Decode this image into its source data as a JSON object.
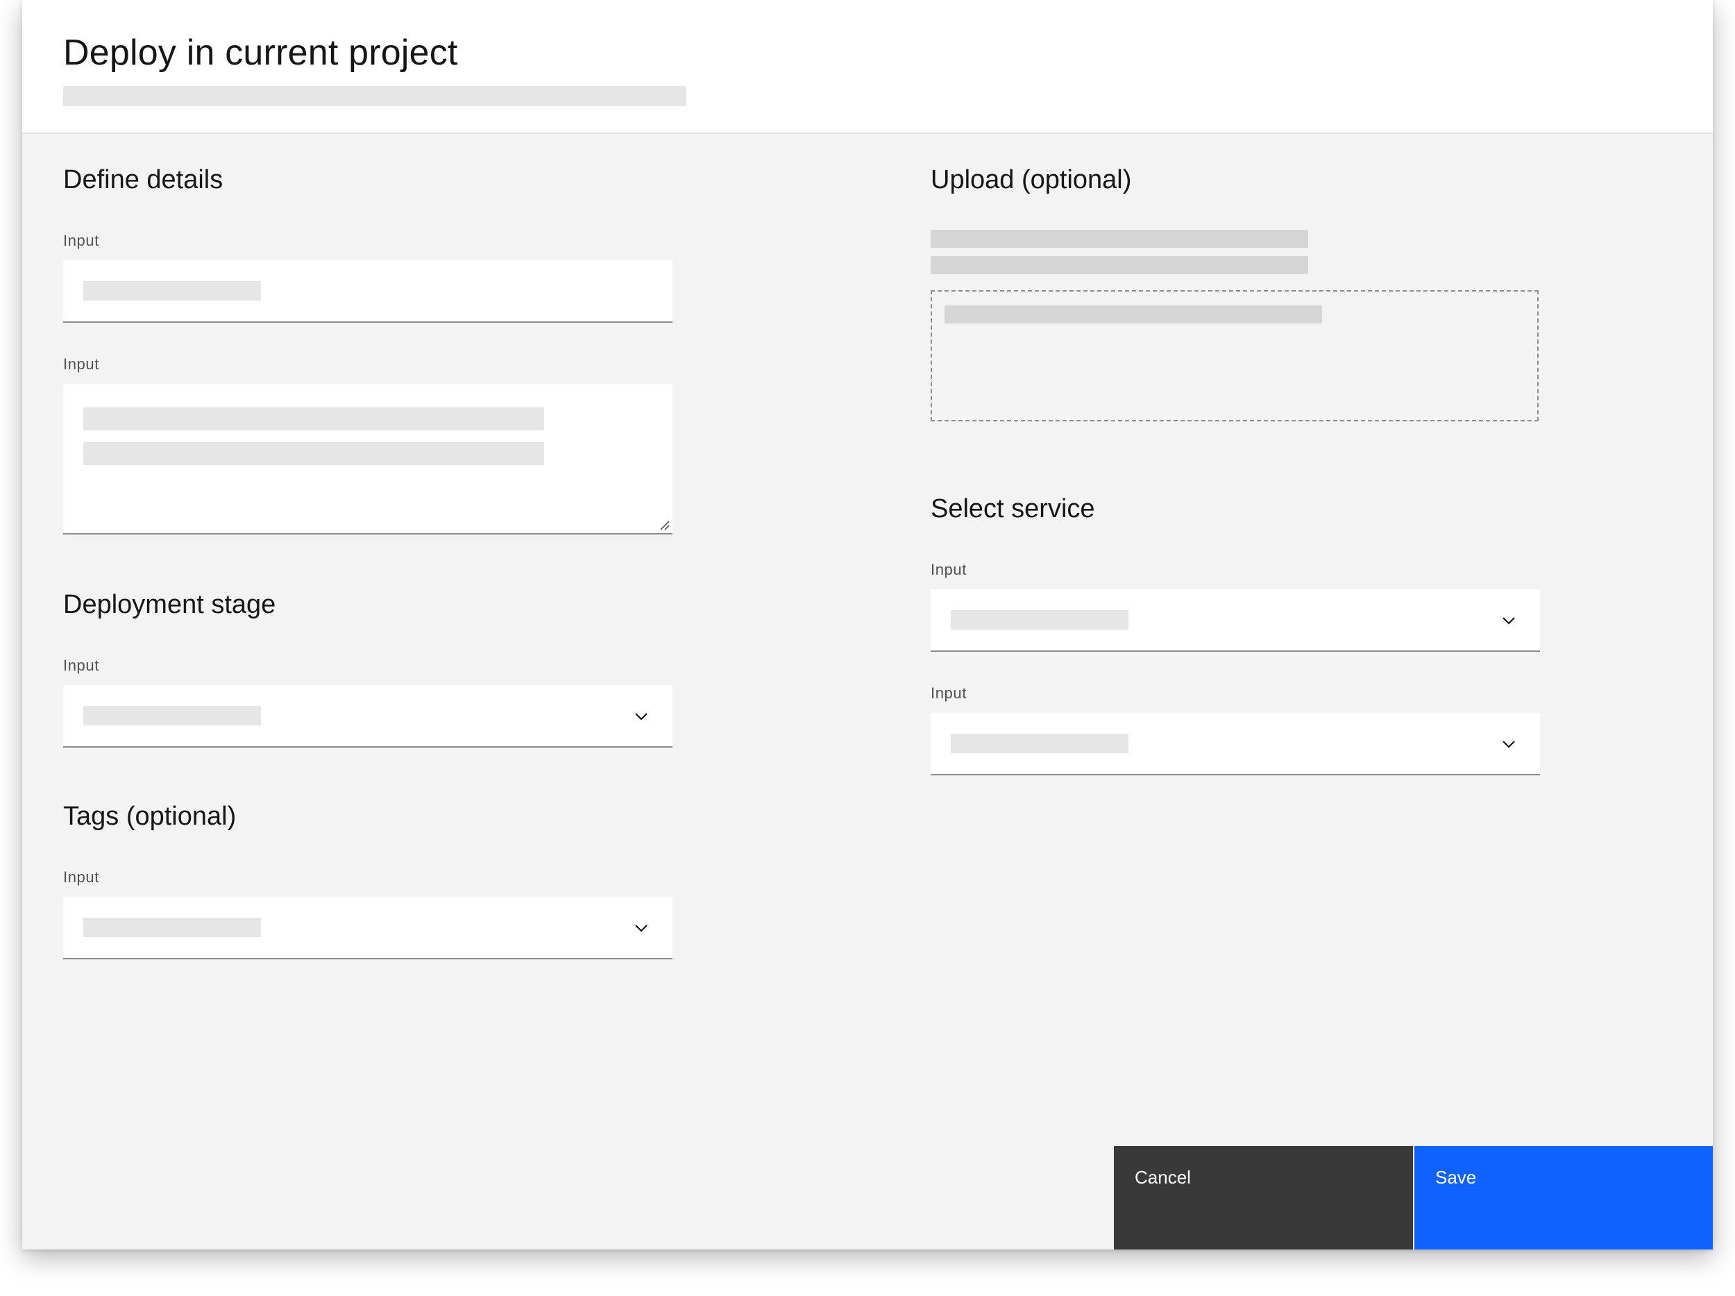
{
  "modal": {
    "title": "Deploy in current project"
  },
  "sections": {
    "define_details": "Define details",
    "deployment_stage": "Deployment stage",
    "tags": "Tags (optional)",
    "upload": "Upload (optional)",
    "select_service": "Select service"
  },
  "fields": {
    "label": "Input"
  },
  "icons": {
    "dropdown": "chevron-down-icon",
    "resize": "resize-handle-icon"
  },
  "footer": {
    "cancel_label": "Cancel",
    "save_label": "Save"
  },
  "colors": {
    "primary": "#0f62fe",
    "secondary": "#393939",
    "background": "#f3f3f3"
  }
}
